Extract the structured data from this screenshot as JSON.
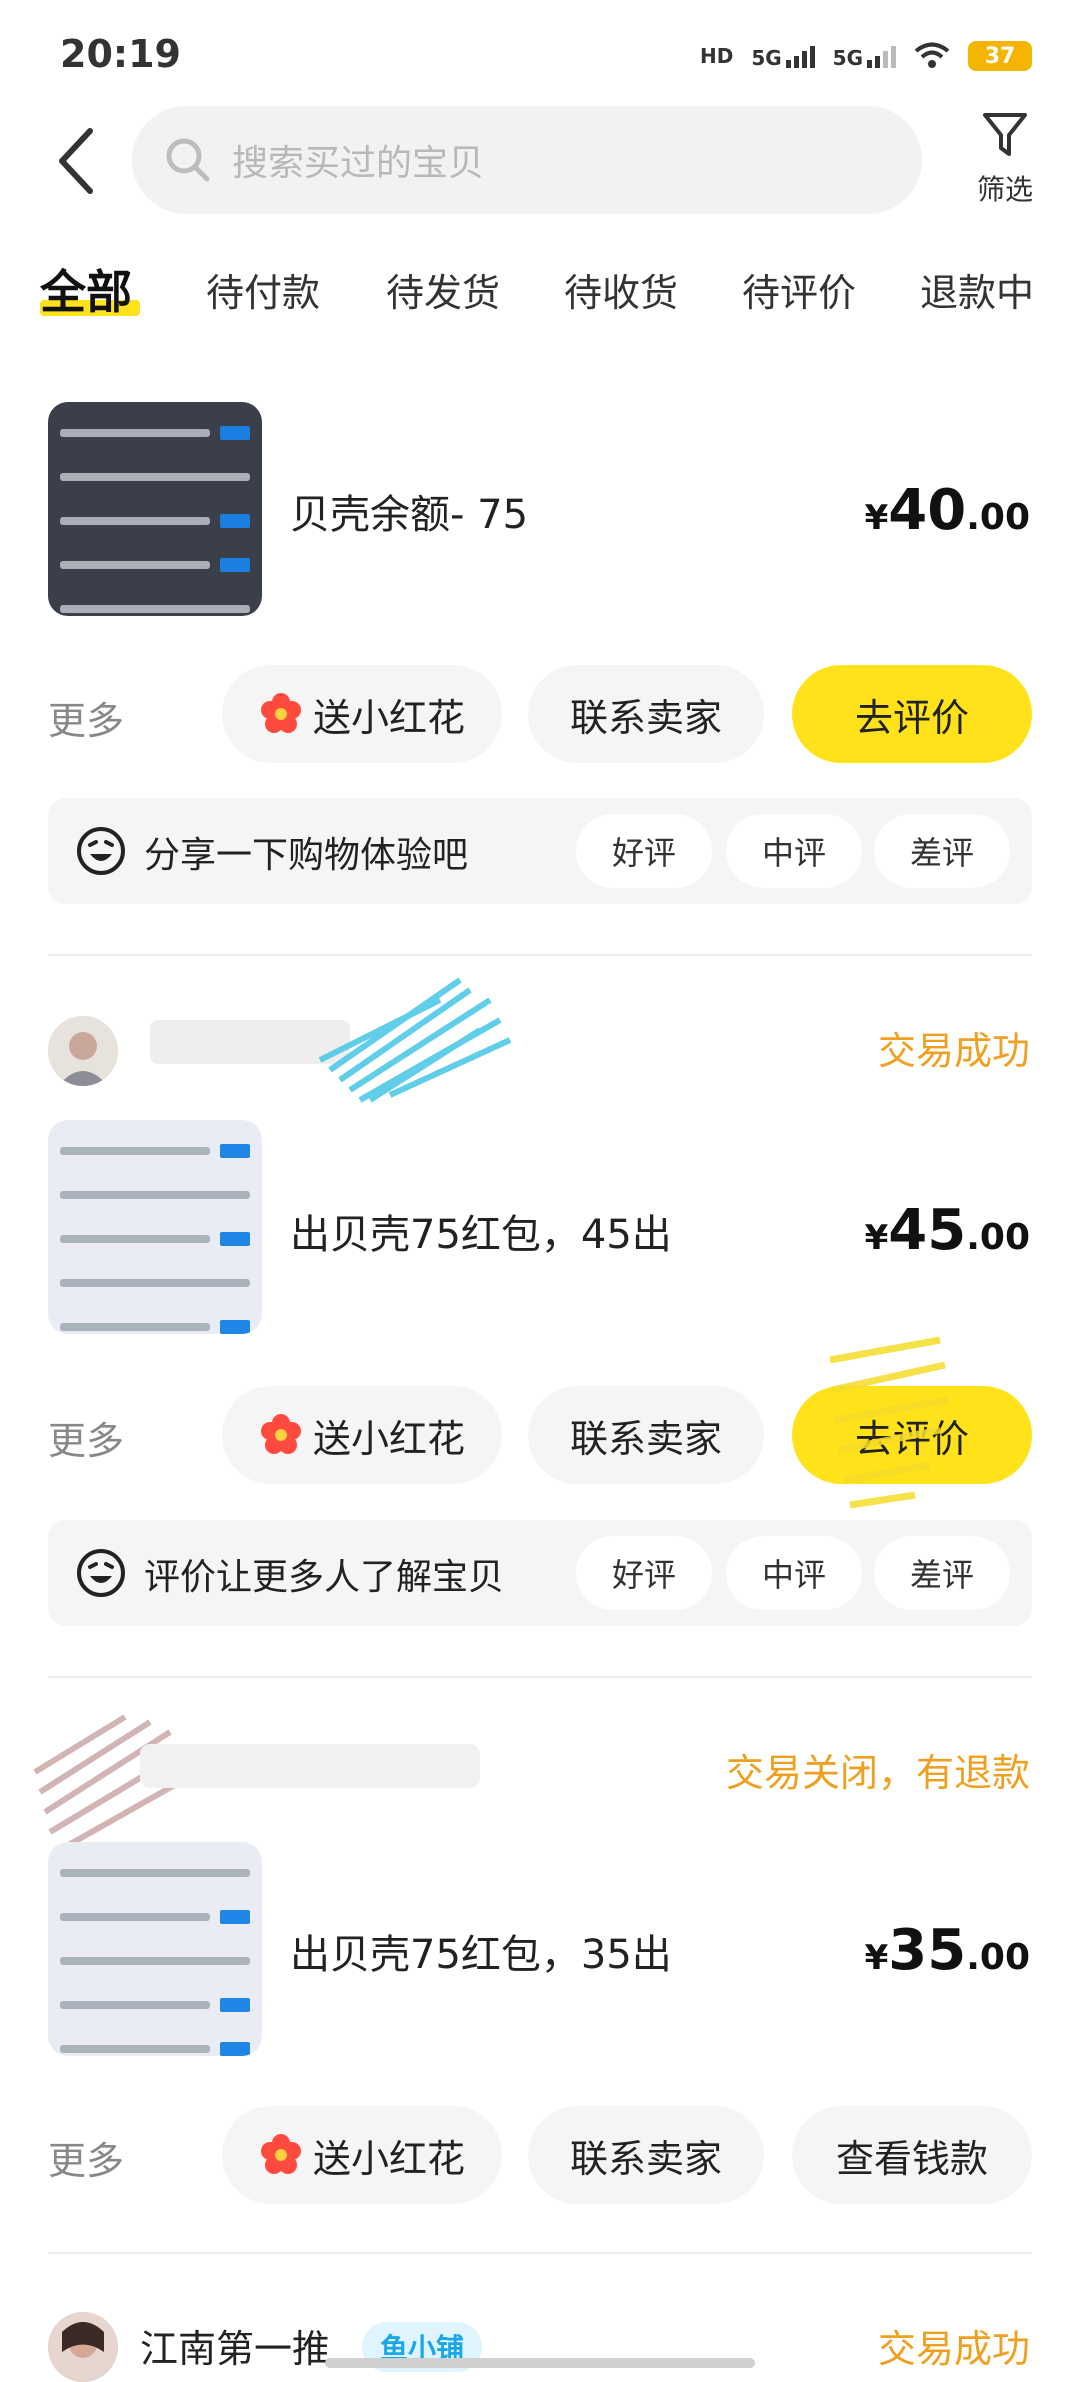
{
  "status_bar": {
    "time": "20:19",
    "hd_label": "HD",
    "net1": "5G",
    "net2": "5G",
    "battery": "37"
  },
  "header": {
    "search_placeholder": "搜索买过的宝贝",
    "filter_label": "筛选"
  },
  "tabs": [
    "全部",
    "待付款",
    "待发货",
    "待收货",
    "待评价",
    "退款中"
  ],
  "orders": [
    {
      "title": "贝壳余额- 75",
      "price_currency": "¥",
      "price_int": "40",
      "price_dec": ".00",
      "more": "更多",
      "flower_btn": "送小红花",
      "contact_btn": "联系卖家",
      "action_btn": "去评价",
      "review_prompt": "分享一下购物体验吧",
      "review_options": [
        "好评",
        "中评",
        "差评"
      ]
    },
    {
      "status": "交易成功",
      "title": "出贝壳75红包，45出",
      "price_currency": "¥",
      "price_int": "45",
      "price_dec": ".00",
      "more": "更多",
      "flower_btn": "送小红花",
      "contact_btn": "联系卖家",
      "action_btn": "去评价",
      "review_prompt": "评价让更多人了解宝贝",
      "review_options": [
        "好评",
        "中评",
        "差评"
      ]
    },
    {
      "status": "交易关闭，有退款",
      "title": "出贝壳75红包，35出",
      "price_currency": "¥",
      "price_int": "35",
      "price_dec": ".00",
      "more": "更多",
      "flower_btn": "送小红花",
      "contact_btn": "联系卖家",
      "action_btn": "查看钱款"
    },
    {
      "shop_name": "江南第一推",
      "shop_badge": "鱼小铺",
      "status": "交易成功"
    }
  ],
  "colors": {
    "accent_yellow": "#ffe21a",
    "status_orange": "#f0a020",
    "badge_blue": "#1aa7e8"
  }
}
